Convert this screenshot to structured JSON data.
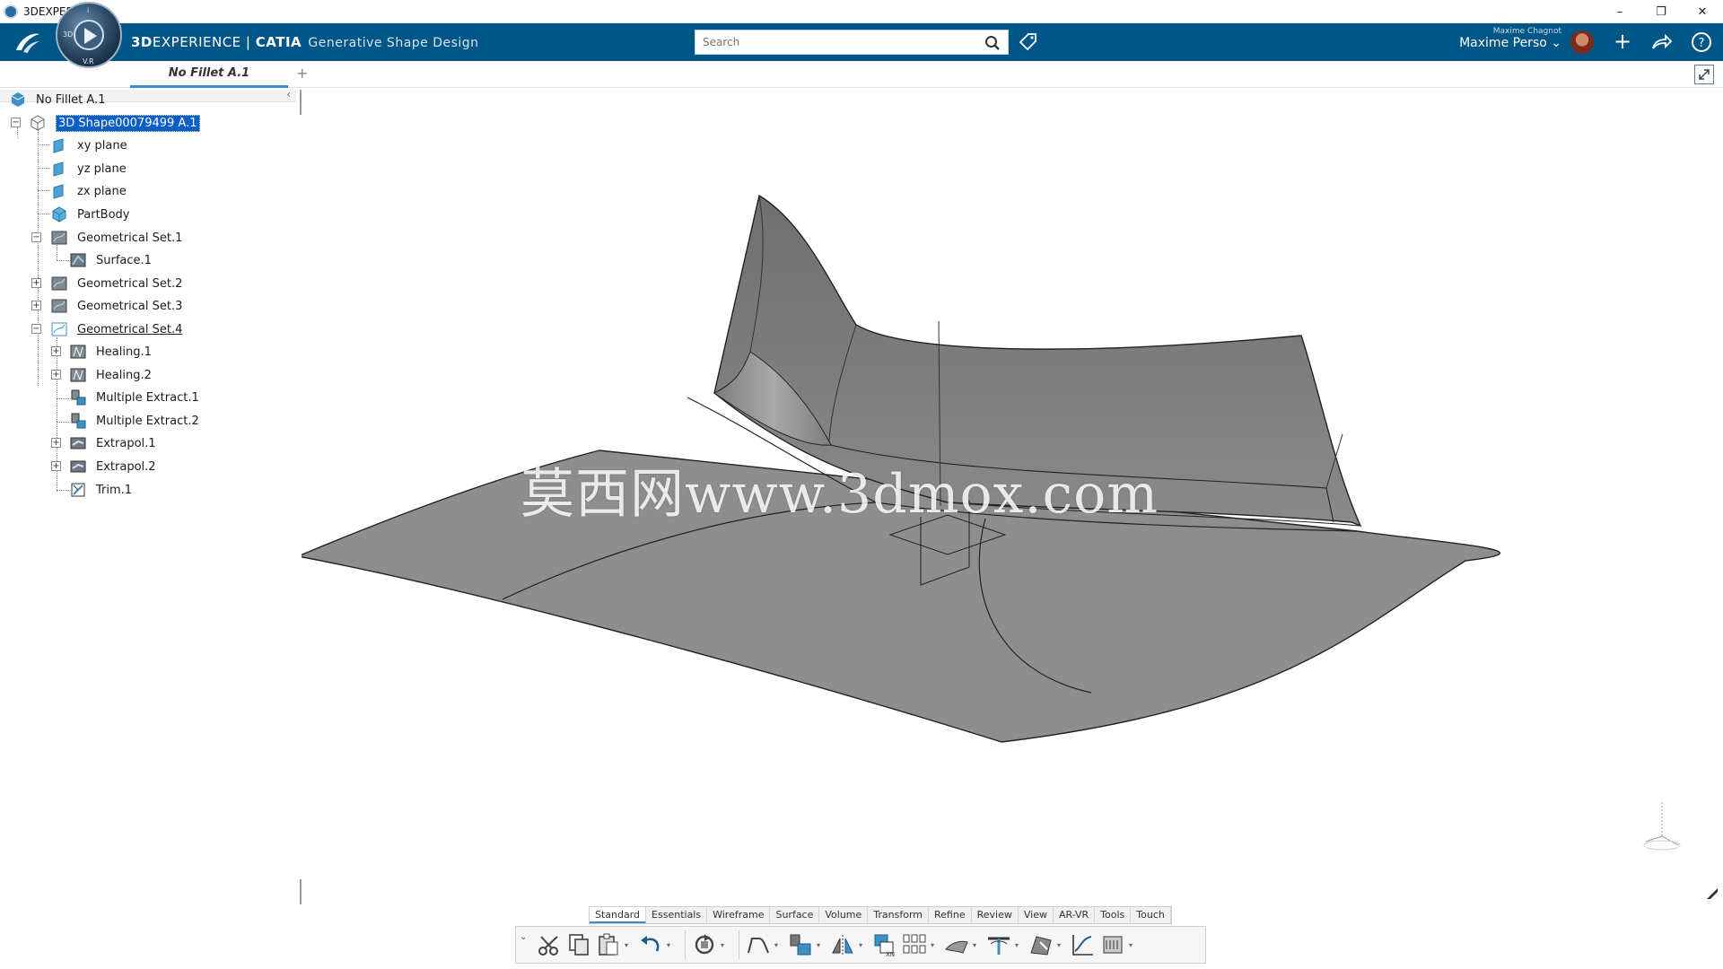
{
  "window": {
    "title": "3DEXPERIENCE",
    "controls": [
      "–",
      "❐",
      "✕"
    ]
  },
  "header": {
    "brand_strong": "3D",
    "brand_rest": "EXPERIENCE | ",
    "brand_catia": "CATIA",
    "app_name": "Generative Shape Design",
    "search_placeholder": "Search",
    "user_small": "Maxime Chagnot",
    "user_name": "Maxime Perso",
    "compass_labels": [
      "3D",
      "V.R",
      "i"
    ],
    "accent": "#005686"
  },
  "tabs": {
    "active": "No Fillet A.1",
    "add": "+"
  },
  "tree": {
    "root": "No Fillet A.1",
    "shape": "3D Shape00079499 A.1",
    "items": [
      {
        "label": "xy plane",
        "icon": "plane-icon"
      },
      {
        "label": "yz plane",
        "icon": "plane-icon"
      },
      {
        "label": "zx plane",
        "icon": "plane-icon"
      },
      {
        "label": "PartBody",
        "icon": "partbody-icon"
      },
      {
        "label": "Geometrical Set.1",
        "icon": "geoset-icon"
      },
      {
        "label": "Surface.1",
        "icon": "surface-icon"
      },
      {
        "label": "Geometrical Set.2",
        "icon": "geoset-icon"
      },
      {
        "label": "Geometrical Set.3",
        "icon": "geoset-icon"
      },
      {
        "label": "Geometrical Set.4",
        "icon": "geoset-icon"
      },
      {
        "label": "Healing.1",
        "icon": "healing-icon"
      },
      {
        "label": "Healing.2",
        "icon": "healing-icon"
      },
      {
        "label": "Multiple Extract.1",
        "icon": "extract-icon"
      },
      {
        "label": "Multiple Extract.2",
        "icon": "extract-icon"
      },
      {
        "label": "Extrapol.1",
        "icon": "extrapol-icon"
      },
      {
        "label": "Extrapol.2",
        "icon": "extrapol-icon"
      },
      {
        "label": "Trim.1",
        "icon": "trim-icon"
      }
    ]
  },
  "viewport": {
    "watermark": "莫西网www.3dmox.com"
  },
  "action_tabs": [
    "Standard",
    "Essentials",
    "Wireframe",
    "Surface",
    "Volume",
    "Transform",
    "Refine",
    "Review",
    "View",
    "AR-VR",
    "Tools",
    "Touch"
  ],
  "action_tab_active": "Standard"
}
